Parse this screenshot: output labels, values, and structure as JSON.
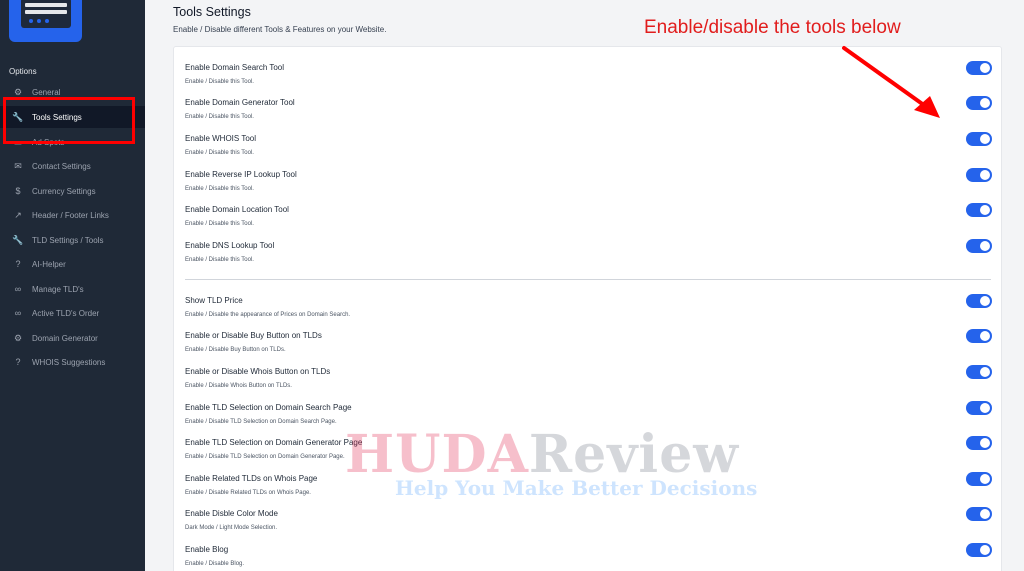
{
  "sidebar": {
    "section_label": "Options",
    "items": [
      {
        "label": "General",
        "icon": "gear-icon",
        "glyph": "⚙"
      },
      {
        "label": "Tools Settings",
        "icon": "wrench-icon",
        "glyph": "🔧"
      },
      {
        "label": "Ad Spots",
        "icon": "monitor-icon",
        "glyph": "▭"
      },
      {
        "label": "Contact Settings",
        "icon": "mail-icon",
        "glyph": "✉"
      },
      {
        "label": "Currency Settings",
        "icon": "dollar-icon",
        "glyph": "$"
      },
      {
        "label": "Header / Footer Links",
        "icon": "external-link-icon",
        "glyph": "↗"
      },
      {
        "label": "TLD Settings / Tools",
        "icon": "wrench-icon",
        "glyph": "🔧"
      },
      {
        "label": "AI-Helper",
        "icon": "help-circle-icon",
        "glyph": "?"
      },
      {
        "label": "Manage TLD's",
        "icon": "link-icon",
        "glyph": "∞"
      },
      {
        "label": "Active TLD's Order",
        "icon": "link-icon",
        "glyph": "∞"
      },
      {
        "label": "Domain Generator",
        "icon": "gear-icon",
        "glyph": "⚙"
      },
      {
        "label": "WHOIS Suggestions",
        "icon": "help-circle-icon",
        "glyph": "?"
      }
    ]
  },
  "main": {
    "title": "Tools Settings",
    "subtitle": "Enable / Disable different Tools & Features on your Website.",
    "annotation": "Enable/disable the tools below",
    "settings": [
      {
        "label": "Enable Domain Search Tool",
        "desc": "Enable / Disable this Tool.",
        "enabled": true
      },
      {
        "label": "Enable Domain Generator Tool",
        "desc": "Enable / Disable this Tool.",
        "enabled": true
      },
      {
        "label": "Enable WHOIS Tool",
        "desc": "Enable / Disable this Tool.",
        "enabled": true
      },
      {
        "label": "Enable Reverse IP Lookup Tool",
        "desc": "Enable / Disable this Tool.",
        "enabled": true
      },
      {
        "label": "Enable Domain Location Tool",
        "desc": "Enable / Disable this Tool.",
        "enabled": true
      },
      {
        "label": "Enable DNS Lookup Tool",
        "desc": "Enable / Disable this Tool.",
        "enabled": true
      },
      {
        "label": "Show TLD Price",
        "desc": "Enable / Disable the appearance of Prices on Domain Search.",
        "enabled": true
      },
      {
        "label": "Enable or Disable Buy Button on TLDs",
        "desc": "Enable / Disable Buy Button on TLDs.",
        "enabled": true
      },
      {
        "label": "Enable or Disable Whois Button on TLDs",
        "desc": "Enable / Disable Whois Button on TLDs.",
        "enabled": true
      },
      {
        "label": "Enable TLD Selection on Domain Search Page",
        "desc": "Enable / Disable TLD Selection on Domain Search Page.",
        "enabled": true
      },
      {
        "label": "Enable TLD Selection on Domain Generator Page",
        "desc": "Enable / Disable TLD Selection on Domain Generator Page.",
        "enabled": true
      },
      {
        "label": "Enable Related TLDs on Whois Page",
        "desc": "Enable / Disable Related TLDs on Whois Page.",
        "enabled": true
      },
      {
        "label": "Enable Disble Color Mode",
        "desc": "Dark Mode / Light Mode Selection.",
        "enabled": true
      },
      {
        "label": "Enable Blog",
        "desc": "Enable / Disable Blog.",
        "enabled": true
      }
    ]
  },
  "watermark": {
    "brand_a": "HUDA",
    "brand_b": "Review",
    "tagline": "Help You Make Better Decisions"
  },
  "colors": {
    "accent": "#2563eb",
    "sidebar_bg": "#1f2937",
    "annotation_red": "#e11d1d"
  }
}
